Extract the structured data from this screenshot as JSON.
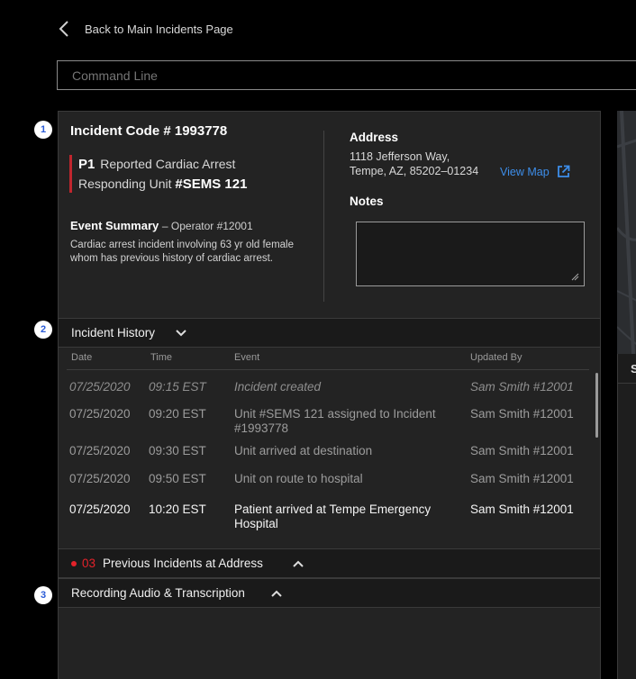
{
  "nav": {
    "back_label": "Back to Main Incidents Page"
  },
  "command_line": {
    "placeholder": "Command Line"
  },
  "incident": {
    "step_badge": "1",
    "code_label": "Incident Code # 1993778",
    "priority": "P1",
    "priority_text": "Reported Cardiac Arrest",
    "responding_label": "Responding Unit",
    "responding_unit": "#SEMS 121",
    "event_summary_label": "Event Summary",
    "event_summary_operator": "– Operator #12001",
    "event_summary_text": "Cardiac arrest incident involving 63 yr old female whom has previous history of cardiac arrest.",
    "address_label": "Address",
    "address_line1": "1118 Jefferson Way,",
    "address_line2": "Tempe, AZ, 85202–01234",
    "view_map_label": "View Map",
    "notes_label": "Notes"
  },
  "history": {
    "step_badge": "2",
    "title": "Incident History",
    "columns": [
      "Date",
      "Time",
      "Event",
      "Updated By"
    ],
    "rows": [
      {
        "date": "07/25/2020",
        "time": "09:15 EST",
        "event": "Incident created",
        "updated_by": "Sam Smith #12001"
      },
      {
        "date": "07/25/2020",
        "time": "09:20 EST",
        "event": "Unit #SEMS 121 assigned to Incident #1993778",
        "updated_by": "Sam Smith #12001"
      },
      {
        "date": "07/25/2020",
        "time": "09:30 EST",
        "event": "Unit arrived at destination",
        "updated_by": "Sam Smith #12001"
      },
      {
        "date": "07/25/2020",
        "time": "09:50 EST",
        "event": "Unit on route to hospital",
        "updated_by": "Sam Smith #12001"
      },
      {
        "date": "07/25/2020",
        "time": "10:20 EST",
        "event": "Patient arrived at Tempe Emergency Hospital",
        "updated_by": "Sam Smith #12001"
      }
    ]
  },
  "previous": {
    "count": "03",
    "label": "Previous Incidents at Address"
  },
  "recording": {
    "step_badge": "3",
    "title": "Recording Audio & Transcription"
  },
  "right_panel": {
    "header_initial": "S"
  },
  "colors": {
    "accent_blue": "#3d8eea",
    "priority_red": "#c0262e",
    "alert_red": "#e4222a",
    "badge_blue": "#2a5bd7"
  },
  "icons": [
    "chevron-left-icon",
    "external-link-icon",
    "chevron-down-icon",
    "chevron-up-icon",
    "resize-grip-icon"
  ]
}
